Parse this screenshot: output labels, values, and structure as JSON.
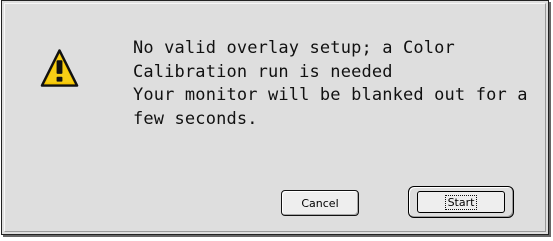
{
  "dialog": {
    "message_lines": [
      "No valid overlay setup; a Color",
      "Calibration run is needed",
      "Your monitor will be blanked out for a",
      "few seconds."
    ],
    "icon": "caution-icon",
    "buttons": {
      "cancel_label": "Cancel",
      "start_label": "Start"
    }
  },
  "colors": {
    "dialog_background": "#dedede",
    "warning_yellow": "#f4c400",
    "text": "#111111"
  }
}
